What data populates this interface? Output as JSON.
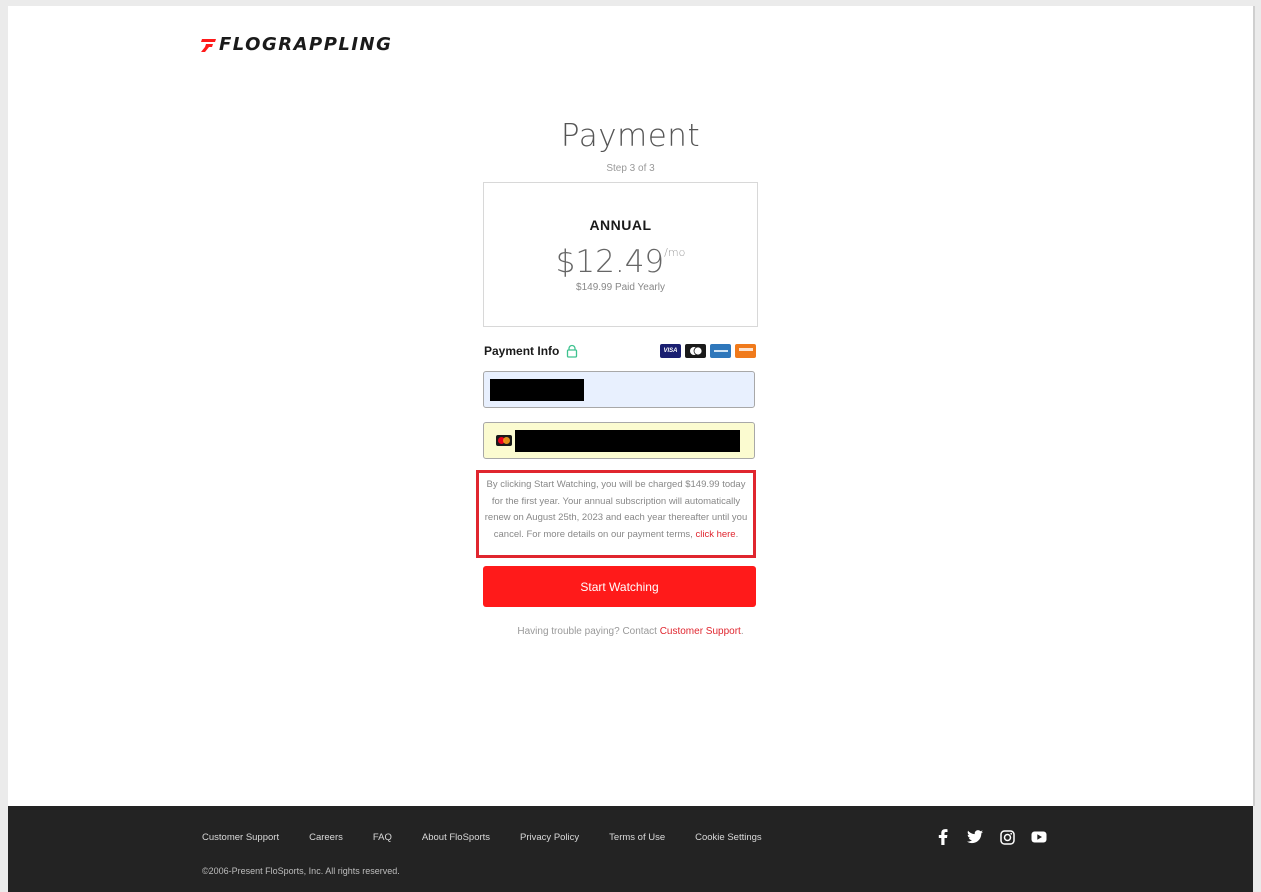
{
  "brand": {
    "logo_text_bold": "FLO",
    "logo_text_rest": "GRAPPLING",
    "accent": "#ff1a1a"
  },
  "page": {
    "title": "Payment",
    "step": "Step 3 of 3"
  },
  "plan": {
    "name": "ANNUAL",
    "price": "$12.49",
    "per": "/mo",
    "billed": "$149.99 Paid Yearly"
  },
  "payment": {
    "label": "Payment Info",
    "lock_icon": "lock-icon",
    "accepted_cards": [
      {
        "name": "visa-card-icon",
        "text": "VISA"
      },
      {
        "name": "mastercard-card-icon",
        "text": ""
      },
      {
        "name": "amex-card-icon",
        "text": ""
      },
      {
        "name": "discover-card-icon",
        "text": ""
      }
    ]
  },
  "terms": {
    "text": "By clicking Start Watching, you will be charged $149.99 today for the first year. Your annual subscription will automatically renew on August 25th, 2023 and each year thereafter until you cancel. For more details on our payment terms, ",
    "link": "click here",
    "end": "."
  },
  "actions": {
    "start_label": "Start Watching"
  },
  "help": {
    "text": "Having trouble paying? Contact ",
    "link": "Customer Support",
    "end": "."
  },
  "footer": {
    "links": [
      "Customer Support",
      "Careers",
      "FAQ",
      "About FloSports",
      "Privacy Policy",
      "Terms of Use",
      "Cookie Settings"
    ],
    "copyright": "©2006-Present FloSports, Inc. All rights reserved.",
    "social": [
      "facebook-icon",
      "twitter-icon",
      "instagram-icon",
      "youtube-icon"
    ]
  }
}
